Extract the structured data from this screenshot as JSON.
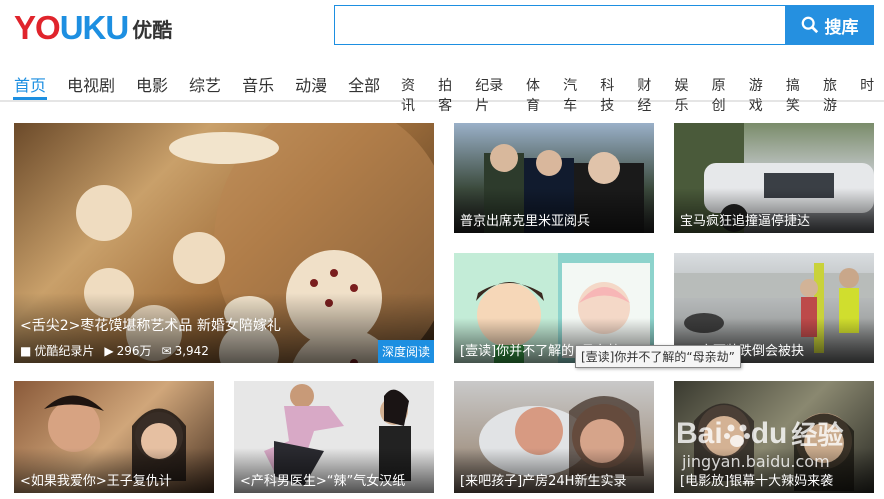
{
  "header": {
    "logo_en": [
      "Y",
      "O",
      "U",
      "K",
      "U"
    ],
    "logo_cn": "优酷",
    "search_placeholder": "",
    "search_button": "搜库"
  },
  "nav": {
    "main": [
      "首页",
      "电视剧",
      "电影",
      "综艺",
      "音乐",
      "动漫",
      "全部"
    ],
    "active": "首页",
    "sub": [
      "资讯",
      "拍客",
      "纪录片",
      "体育",
      "汽车",
      "科技",
      "财经",
      "娱乐",
      "原创",
      "游戏",
      "搞笑",
      "旅游",
      "时"
    ]
  },
  "featured": {
    "title": "<舌尖2>枣花馍堪称艺术品 新婚女陪嫁礼",
    "channel": "优酷纪录片",
    "plays": "296万",
    "comments": "3,942",
    "badge": "深度阅读"
  },
  "tiles": [
    {
      "title": "普京出席克里米亚阅兵"
    },
    {
      "title": "宝马疯狂追撞逼停捷达"
    },
    {
      "title": "[壹读]你并不了解的“母亲劫”"
    },
    {
      "title": "穿西装跌倒会被抉"
    },
    {
      "title": "<如果我爱你>王子复仇计"
    },
    {
      "title": "<产科男医生>“辣”气女汉纸"
    },
    {
      "title": "[来吧孩子]产房24H新生实录"
    },
    {
      "title": "[电影放]银幕十大辣妈来袭"
    }
  ],
  "tooltip": "[壹读]你并不了解的“母亲劫”",
  "watermark": {
    "top": "Bai",
    "paw": "du",
    "cn": "经验",
    "bottom": "jingyan.baidu.com"
  },
  "colors": {
    "brand_blue": "#1d8fe1",
    "brand_red": "#e0242c"
  }
}
